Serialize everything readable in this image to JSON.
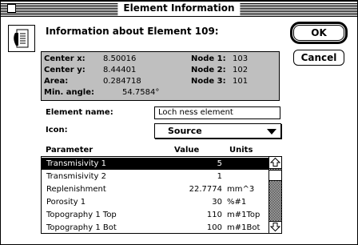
{
  "window": {
    "title": "Element Information"
  },
  "header": {
    "heading": "Information about Element 109:"
  },
  "buttons": {
    "ok": "OK",
    "cancel": "Cancel"
  },
  "info": {
    "center_x_label": "Center x:",
    "center_x": "8.50016",
    "center_y_label": "Center y:",
    "center_y": "8.44401",
    "area_label": "Area:",
    "area": "0.284718",
    "min_angle_label": "Min. angle:",
    "min_angle": "54.7584°",
    "node1_label": "Node 1:",
    "node1": "103",
    "node2_label": "Node 2:",
    "node2": "102",
    "node3_label": "Node 3:",
    "node3": "101"
  },
  "element_name": {
    "label": "Element name:",
    "value": "Loch ness element"
  },
  "icon_field": {
    "label": "Icon:",
    "selected": "Source"
  },
  "table": {
    "headers": {
      "parameter": "Parameter",
      "value": "Value",
      "units": "Units"
    },
    "rows": [
      {
        "parameter": "Transmisivity 1",
        "value": "5",
        "units": ""
      },
      {
        "parameter": "Transmisivity 2",
        "value": "1",
        "units": ""
      },
      {
        "parameter": "Replenishment",
        "value": "22.7774",
        "units": "mm^3"
      },
      {
        "parameter": "Porosity 1",
        "value": "30",
        "units": "%#1"
      },
      {
        "parameter": "Topography 1 Top",
        "value": "110",
        "units": "m#1Top"
      },
      {
        "parameter": "Topography 1 Bot",
        "value": "100",
        "units": "m#1Bot"
      }
    ]
  },
  "icons": {
    "app": "document-face-icon",
    "scroll_up": "arrow-up-icon",
    "scroll_down": "arrow-down-icon",
    "popup": "triangle-down-icon"
  }
}
